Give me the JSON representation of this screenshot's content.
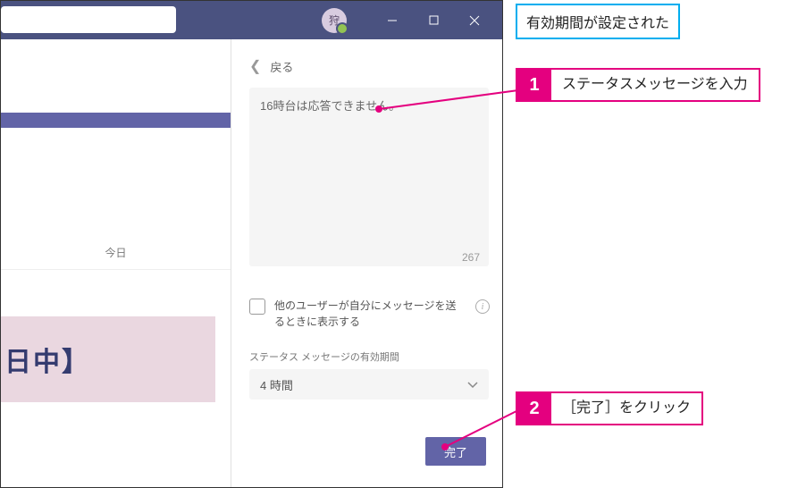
{
  "titlebar": {
    "avatar_initial": "狩"
  },
  "left": {
    "today": "今日",
    "banner": "日中】"
  },
  "panel": {
    "back_label": "戻る",
    "message_value": "16時台は応答できません。",
    "char_count": "267",
    "checkbox_label": "他のユーザーが自分にメッセージを送るときに表示する",
    "expiry_section_label": "ステータス メッセージの有効期間",
    "expiry_value": "4 時間",
    "done_label": "完了"
  },
  "callouts": {
    "top": "有効期間が設定された",
    "step1_num": "1",
    "step1_text": "ステータスメッセージを入力",
    "step2_num": "2",
    "step2_text": "［完了］をクリック"
  }
}
